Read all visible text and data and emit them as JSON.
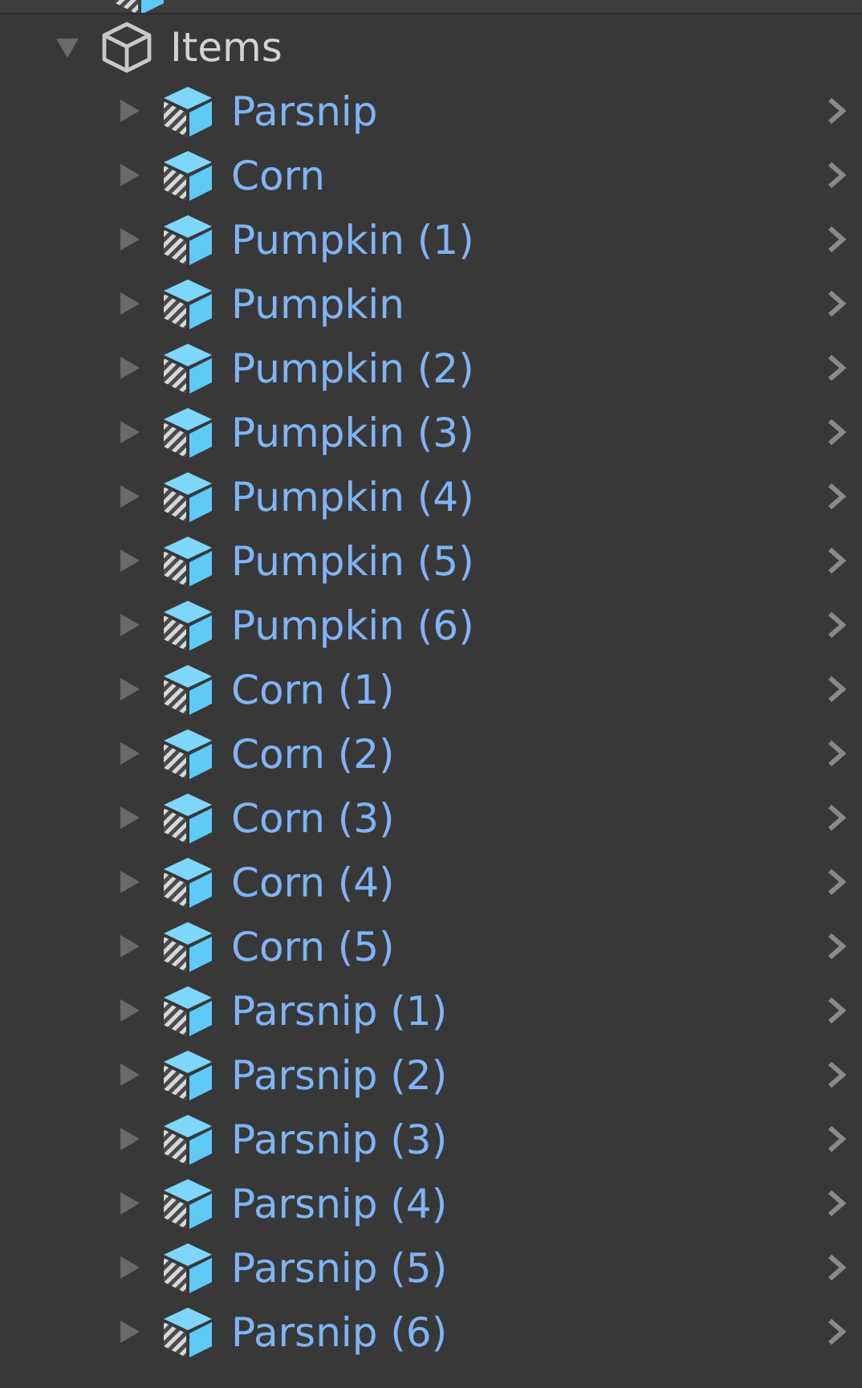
{
  "hierarchy": {
    "label": "Items",
    "kind": "object",
    "expanded": true,
    "children": [
      {
        "label": "Parsnip",
        "kind": "prefab",
        "expanded": false
      },
      {
        "label": "Corn",
        "kind": "prefab",
        "expanded": false
      },
      {
        "label": "Pumpkin (1)",
        "kind": "prefab",
        "expanded": false
      },
      {
        "label": "Pumpkin",
        "kind": "prefab",
        "expanded": false
      },
      {
        "label": "Pumpkin (2)",
        "kind": "prefab",
        "expanded": false
      },
      {
        "label": "Pumpkin (3)",
        "kind": "prefab",
        "expanded": false
      },
      {
        "label": "Pumpkin (4)",
        "kind": "prefab",
        "expanded": false
      },
      {
        "label": "Pumpkin (5)",
        "kind": "prefab",
        "expanded": false
      },
      {
        "label": "Pumpkin (6)",
        "kind": "prefab",
        "expanded": false
      },
      {
        "label": "Corn (1)",
        "kind": "prefab",
        "expanded": false
      },
      {
        "label": "Corn (2)",
        "kind": "prefab",
        "expanded": false
      },
      {
        "label": "Corn (3)",
        "kind": "prefab",
        "expanded": false
      },
      {
        "label": "Corn (4)",
        "kind": "prefab",
        "expanded": false
      },
      {
        "label": "Corn (5)",
        "kind": "prefab",
        "expanded": false
      },
      {
        "label": "Parsnip (1)",
        "kind": "prefab",
        "expanded": false
      },
      {
        "label": "Parsnip (2)",
        "kind": "prefab",
        "expanded": false
      },
      {
        "label": "Parsnip (3)",
        "kind": "prefab",
        "expanded": false
      },
      {
        "label": "Parsnip (4)",
        "kind": "prefab",
        "expanded": false
      },
      {
        "label": "Parsnip (5)",
        "kind": "prefab",
        "expanded": false
      },
      {
        "label": "Parsnip (6)",
        "kind": "prefab",
        "expanded": false
      }
    ]
  }
}
